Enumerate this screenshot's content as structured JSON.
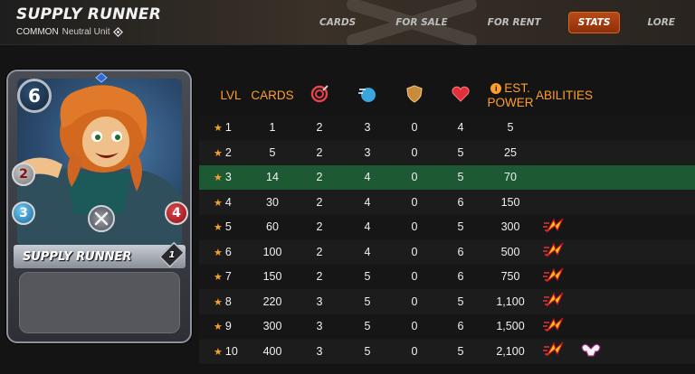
{
  "header": {
    "title": "SUPPLY RUNNER",
    "rarity": "COMMON",
    "unit_type": "Neutral Unit"
  },
  "nav": {
    "tabs": [
      {
        "label": "CARDS",
        "active": false
      },
      {
        "label": "FOR SALE",
        "active": false
      },
      {
        "label": "FOR RENT",
        "active": false
      },
      {
        "label": "STATS",
        "active": true
      },
      {
        "label": "LORE",
        "active": false
      }
    ]
  },
  "card": {
    "name": "SUPPLY RUNNER",
    "mana": "6",
    "melee": "2",
    "speed": "3",
    "health": "4",
    "level": "1"
  },
  "stats": {
    "headers": {
      "lvl": "LVL",
      "cards": "CARDS",
      "power_line1": "EST.",
      "power_line2": "POWER",
      "abilities": "ABILITIES"
    },
    "header_icons": [
      "melee-attack-icon",
      "speed-icon",
      "armor-icon",
      "health-heart-icon"
    ],
    "active_level": 3,
    "rows": [
      {
        "lvl": "1",
        "cards": "1",
        "attack": "2",
        "speed": "3",
        "armor": "0",
        "health": "4",
        "power": "5",
        "abilities": []
      },
      {
        "lvl": "2",
        "cards": "5",
        "attack": "2",
        "speed": "3",
        "armor": "0",
        "health": "5",
        "power": "25",
        "abilities": []
      },
      {
        "lvl": "3",
        "cards": "14",
        "attack": "2",
        "speed": "4",
        "armor": "0",
        "health": "5",
        "power": "70",
        "abilities": []
      },
      {
        "lvl": "4",
        "cards": "30",
        "attack": "2",
        "speed": "4",
        "armor": "0",
        "health": "6",
        "power": "150",
        "abilities": []
      },
      {
        "lvl": "5",
        "cards": "60",
        "attack": "2",
        "speed": "4",
        "armor": "0",
        "health": "5",
        "power": "300",
        "abilities": [
          "swiftness-icon"
        ]
      },
      {
        "lvl": "6",
        "cards": "100",
        "attack": "2",
        "speed": "4",
        "armor": "0",
        "health": "6",
        "power": "500",
        "abilities": [
          "swiftness-icon"
        ]
      },
      {
        "lvl": "7",
        "cards": "150",
        "attack": "2",
        "speed": "5",
        "armor": "0",
        "health": "6",
        "power": "750",
        "abilities": [
          "swiftness-icon"
        ]
      },
      {
        "lvl": "8",
        "cards": "220",
        "attack": "3",
        "speed": "5",
        "armor": "0",
        "health": "5",
        "power": "1,100",
        "abilities": [
          "swiftness-icon"
        ]
      },
      {
        "lvl": "9",
        "cards": "300",
        "attack": "3",
        "speed": "5",
        "armor": "0",
        "health": "6",
        "power": "1,500",
        "abilities": [
          "swiftness-icon"
        ]
      },
      {
        "lvl": "10",
        "cards": "400",
        "attack": "3",
        "speed": "5",
        "armor": "0",
        "health": "5",
        "power": "2,100",
        "abilities": [
          "swiftness-icon",
          "strengthen-icon"
        ]
      }
    ]
  },
  "colors": {
    "accent_orange": "#ff9e2c",
    "active_row": "#1d5a33",
    "active_tab": "#b84a16",
    "star": "#f2a22a"
  }
}
